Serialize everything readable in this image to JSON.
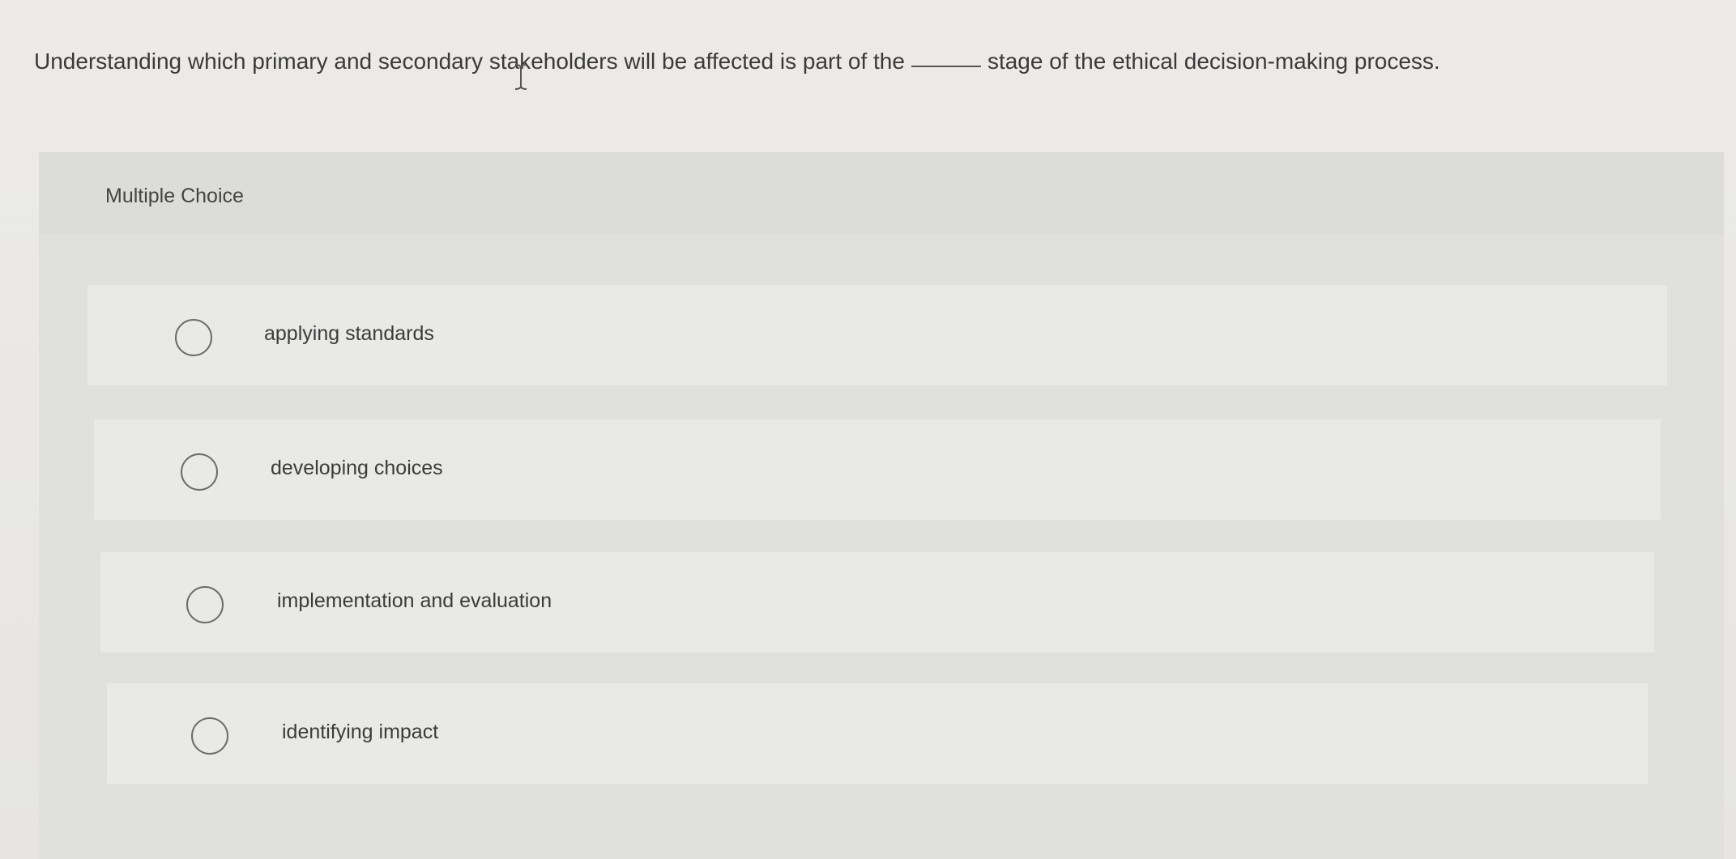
{
  "question": {
    "text_before": "Understanding which primary and secondary stakeholders will be affected is part of the",
    "text_after": "stage of the ethical decision-making process."
  },
  "panel": {
    "type_label": "Multiple Choice"
  },
  "options": [
    {
      "label": "applying standards",
      "selected": false
    },
    {
      "label": "developing choices",
      "selected": false
    },
    {
      "label": "implementation and evaluation",
      "selected": false
    },
    {
      "label": "identifying impact",
      "selected": false
    }
  ]
}
